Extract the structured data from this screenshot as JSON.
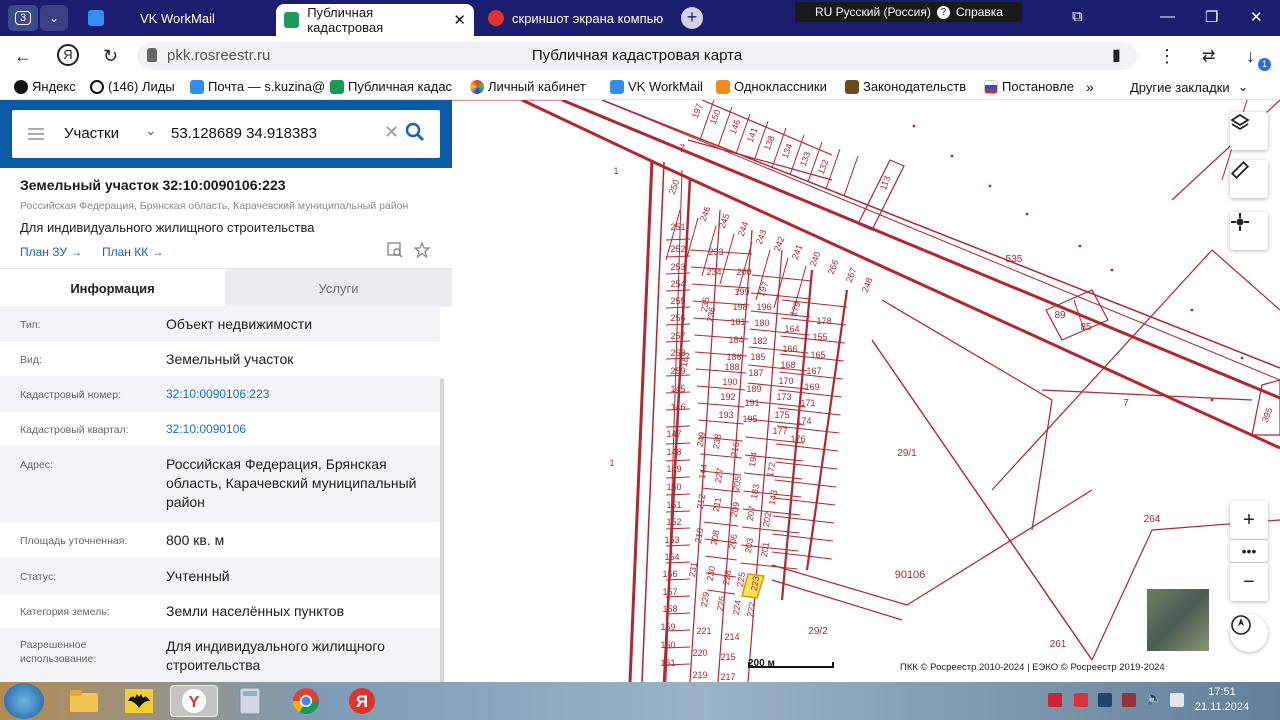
{
  "browser": {
    "tab_count": "3",
    "tabs": [
      {
        "label": "VK WorkMail",
        "icon": "vk-workmail-icon"
      },
      {
        "label": "Публичная кадастровая",
        "icon": "rosreestr-icon"
      },
      {
        "label": "скриншот экрана компью",
        "icon": "yandex-icon"
      }
    ],
    "language": "RU Русский (Россия)",
    "help": "Справка",
    "url_host": "pkk.rosreestr.ru",
    "page_title": "Публичная кадастровая карта",
    "bookmarks": [
      {
        "label": "Яндекс",
        "icon": "yandex-black-icon"
      },
      {
        "label": "(146) Лиды",
        "icon": "arrow-circle-icon"
      },
      {
        "label": "Почта — s.kuzina@",
        "icon": "vk-mail-icon"
      },
      {
        "label": "Публичная кадас",
        "icon": "rosreestr-icon"
      },
      {
        "label": "Личный кабинет",
        "icon": "flower-icon"
      },
      {
        "label": "VK WorkMail",
        "icon": "vk-workmail-icon"
      },
      {
        "label": "Одноклассники",
        "icon": "ok-icon"
      },
      {
        "label": "Законодательств",
        "icon": "law-icon"
      },
      {
        "label": "Постановле",
        "icon": "flag-icon"
      }
    ],
    "more": "»",
    "other_bookmarks": "Другие закладки",
    "downloads_badge": "1"
  },
  "search": {
    "type": "Участки",
    "query": "53.128689 34.918383"
  },
  "parcel": {
    "title": "Земельный участок 32:10:0090106:223",
    "address_line": "Российская Федерация, Брянская область, Карачевский муниципальный район",
    "usage": "Для индивидуального жилищного строительства",
    "link_zu": "План ЗУ →",
    "link_kk": "План КК →",
    "tab_info": "Информация",
    "tab_services": "Услуги",
    "rows": [
      {
        "k": "Тип:",
        "v": "Объект недвижимости"
      },
      {
        "k": "Вид:",
        "v": "Земельный участок"
      },
      {
        "k": "Кадастровый номер:",
        "v": "32:10:0090106:223"
      },
      {
        "k": "Кадастровый квартал:",
        "v": "32:10:0090106"
      },
      {
        "k": "Адрес:",
        "v": "Российская Федерация, Брянская область, Карачевский муниципальный район"
      },
      {
        "k": "Площадь уточненная:",
        "v": "800 кв. м"
      },
      {
        "k": "Статус:",
        "v": "Учтенный"
      },
      {
        "k": "Категория земель:",
        "v": "Земли населённых пунктов"
      },
      {
        "k": "Разрешенное использование:",
        "v": "Для индивидуального жилищного строительства"
      }
    ]
  },
  "map": {
    "scale": "200 м",
    "copyright": "ПКК © Росреестр 2010-2024 | ЕЭКО © Росреестр 2019-2024",
    "labels": [
      "7",
      "1",
      "1",
      "535",
      "29/1",
      "7",
      "90106",
      "264",
      "29/2",
      "261",
      "113",
      "89",
      "85",
      "395",
      "163",
      "250"
    ],
    "colors": {
      "line": "#b3262e",
      "highlight": "#f6e55a"
    }
  },
  "taskbar": {
    "time": "17:51",
    "date": "21.11.2024"
  }
}
